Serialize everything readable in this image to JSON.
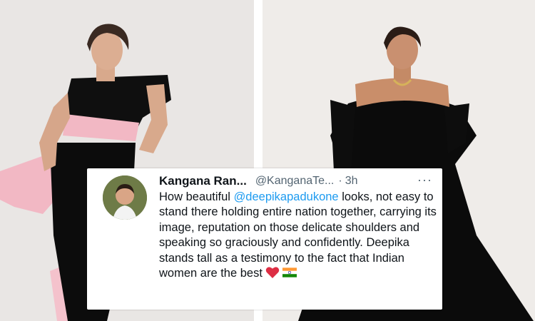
{
  "tweet": {
    "display_name": "Kangana Ran...",
    "handle": "@KanganaTe...",
    "separator": "·",
    "time": "3h",
    "more": "···",
    "text_before_mention": "How beautiful ",
    "mention": "@deepikapadukone",
    "text_after_mention": " looks, not easy to stand there holding entire nation together, carrying its image, reputation on those delicate shoulders and speaking so graciously and confidently. Deepika stands tall as a testimony to the fact that Indian women are the best",
    "emoji": [
      "red-heart",
      "india-flag"
    ]
  },
  "colors": {
    "mention": "#1d9bf0",
    "secondary_text": "#536471",
    "primary_text": "#0f1419",
    "dress_black": "#0c0c0c",
    "sash_pink": "#f2b8c4"
  },
  "photos": [
    {
      "subject": "woman-left",
      "dress": "black off-shoulder dress with pink sash"
    },
    {
      "subject": "woman-right",
      "dress": "black strapless gown"
    }
  ]
}
